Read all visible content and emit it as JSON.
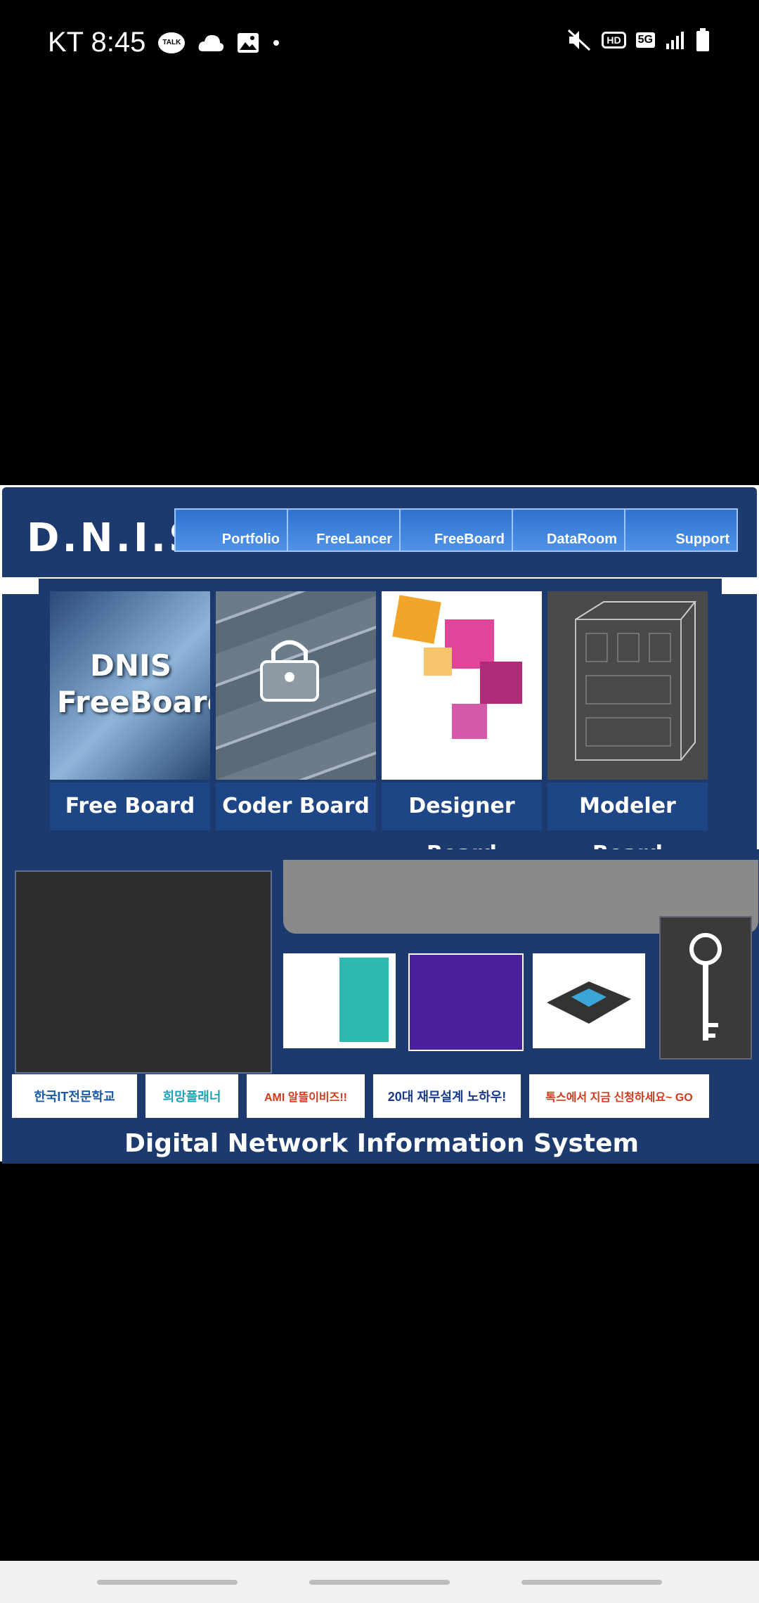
{
  "status_bar": {
    "carrier_time": "KT 8:45",
    "icons": [
      "talk-icon",
      "cloud-icon",
      "image-icon",
      "dot-icon",
      "mute-icon",
      "hd-icon",
      "5g-icon",
      "signal-icon",
      "battery-icon"
    ],
    "hd_label": "HD",
    "fiveg_label": "5G",
    "talk_label": "TALK"
  },
  "site": {
    "logo": "D.N.I.S",
    "nav": [
      "Portfolio",
      "FreeLancer",
      "FreeBoard",
      "DataRoom",
      "Support"
    ],
    "boards": [
      {
        "label": "Free Board",
        "image_text": "DNIS FreeBoard"
      },
      {
        "label": "Coder Board",
        "image_text": ""
      },
      {
        "label": "Designer Board",
        "image_text": ""
      },
      {
        "label": "Modeler Board",
        "image_text": ""
      }
    ],
    "banners": [
      {
        "text": "한국IT전문학교"
      },
      {
        "text": "희망플래너"
      },
      {
        "text": "AMI 알뜰이비즈!!"
      },
      {
        "text": "20대 재무설계 노하우!"
      },
      {
        "text": "톡스에서 지금 신청하세요~ GO"
      }
    ],
    "footer": "Digital Network Information System"
  },
  "colors": {
    "navy": "#1c3a6e",
    "nav_blue": "#3a7fd6"
  }
}
